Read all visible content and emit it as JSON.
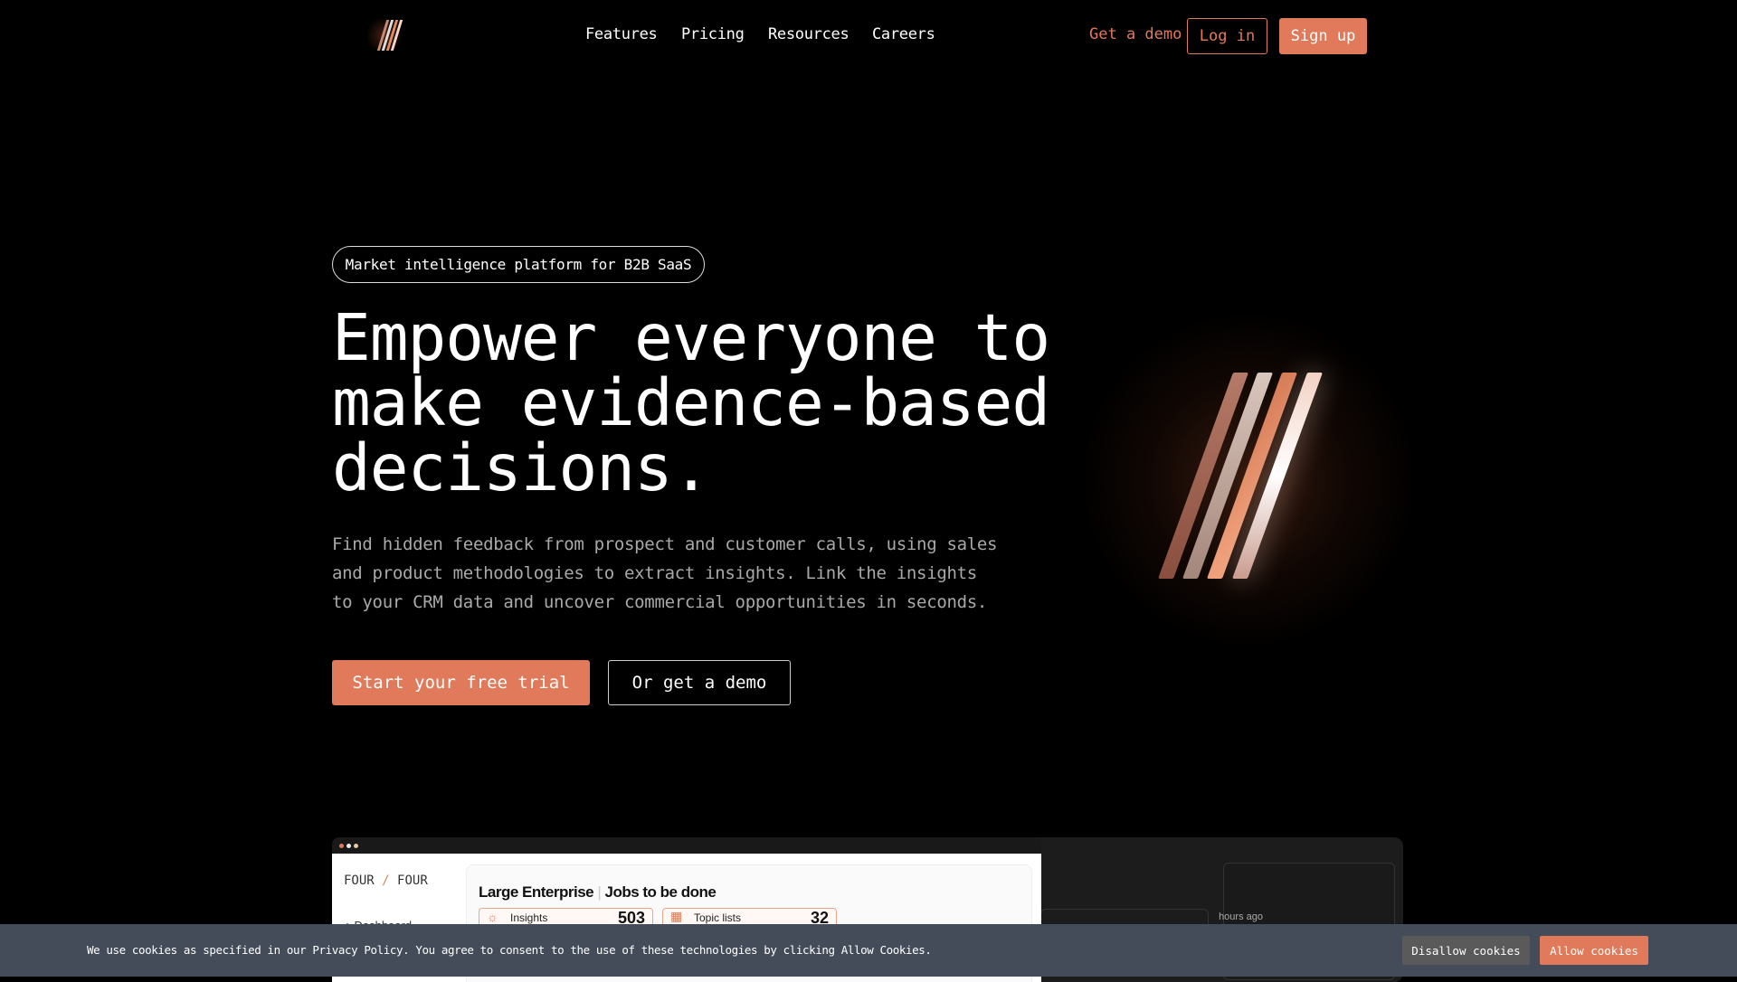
{
  "nav": {
    "links": [
      "Features",
      "Pricing",
      "Resources",
      "Careers"
    ],
    "get_demo": "Get a demo",
    "login": "Log in",
    "signup": "Sign up"
  },
  "hero": {
    "badge": "Market intelligence platform for B2B SaaS",
    "title_lines": [
      "Empower everyone to",
      "make evidence-based",
      "decisions."
    ],
    "paragraph_lines": [
      "Find hidden feedback from prospect and customer calls, using sales",
      "and product methodologies to extract insights. Link the insights",
      "to your CRM data and uncover commercial opportunities in seconds."
    ],
    "cta_primary": "Start your free trial",
    "cta_secondary": "Or get a demo"
  },
  "preview": {
    "brand_left": "FOUR",
    "brand_right": "FOUR",
    "title_left": "Large Enterprise",
    "title_right": "Jobs to be done",
    "cards": [
      {
        "label": "Insights",
        "value": "503",
        "icon": "sun-icon"
      },
      {
        "label": "Topic lists",
        "value": "32",
        "icon": "grid-icon"
      }
    ],
    "sidebar_item": "Dashboard",
    "time_text": "hours ago"
  },
  "cookie": {
    "text": "We use cookies as specified in our Privacy Policy. You agree to consent to the use of these technologies by clicking Allow Cookies.",
    "disallow": "Disallow cookies",
    "allow": "Allow cookies"
  },
  "colors": {
    "accent": "#e07a5a",
    "cookie_bg": "#434c58",
    "disallow_bg": "#5a5a5a"
  }
}
